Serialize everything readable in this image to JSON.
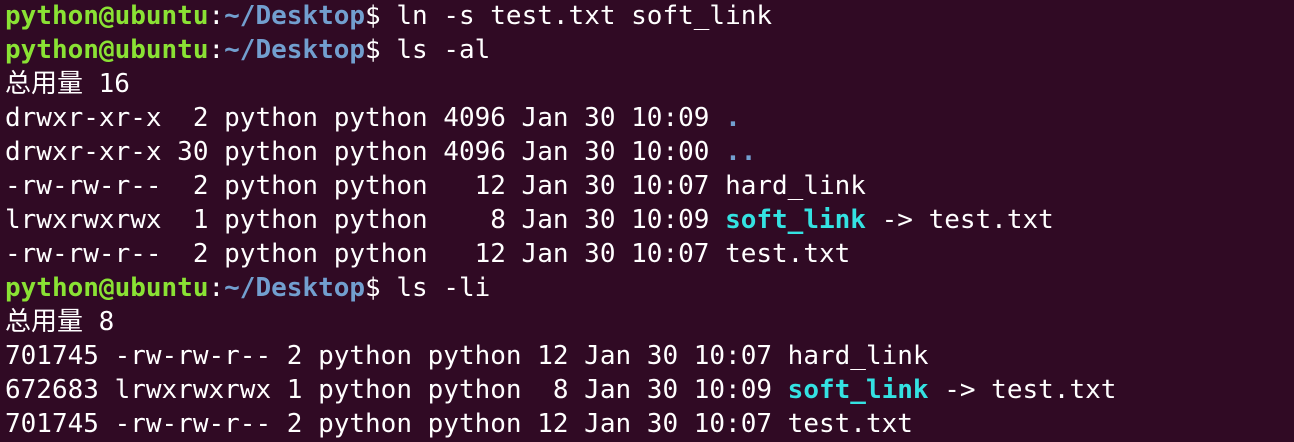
{
  "terminal": {
    "prompt": {
      "user_host": "python@ubuntu",
      "colon": ":",
      "path": "~/Desktop",
      "sign": "$"
    },
    "lines": [
      {
        "kind": "command",
        "command": " ln -s test.txt soft_link"
      },
      {
        "kind": "command",
        "command": " ls -al"
      },
      {
        "kind": "text",
        "text": "总用量 16"
      },
      {
        "kind": "entry",
        "prefix": "drwxr-xr-x  2 python python 4096 Jan 30 10:09 ",
        "name": ".",
        "name_style": "dir",
        "suffix": ""
      },
      {
        "kind": "entry",
        "prefix": "drwxr-xr-x 30 python python 4096 Jan 30 10:00 ",
        "name": "..",
        "name_style": "dir",
        "suffix": ""
      },
      {
        "kind": "entry",
        "prefix": "-rw-rw-r--  2 python python   12 Jan 30 10:07 ",
        "name": "hard_link",
        "name_style": "plain",
        "suffix": ""
      },
      {
        "kind": "entry",
        "prefix": "lrwxrwxrwx  1 python python    8 Jan 30 10:09 ",
        "name": "soft_link",
        "name_style": "link",
        "suffix": " -> test.txt"
      },
      {
        "kind": "entry",
        "prefix": "-rw-rw-r--  2 python python   12 Jan 30 10:07 ",
        "name": "test.txt",
        "name_style": "plain",
        "suffix": ""
      },
      {
        "kind": "command",
        "command": " ls -li"
      },
      {
        "kind": "text",
        "text": "总用量 8"
      },
      {
        "kind": "entry",
        "prefix": "701745 -rw-rw-r-- 2 python python 12 Jan 30 10:07 ",
        "name": "hard_link",
        "name_style": "plain",
        "suffix": ""
      },
      {
        "kind": "entry",
        "prefix": "672683 lrwxrwxrwx 1 python python  8 Jan 30 10:09 ",
        "name": "soft_link",
        "name_style": "link",
        "suffix": " -> test.txt"
      },
      {
        "kind": "entry",
        "prefix": "701745 -rw-rw-r-- 2 python python 12 Jan 30 10:07 ",
        "name": "test.txt",
        "name_style": "plain",
        "suffix": ""
      }
    ]
  },
  "colors": {
    "background": "#300a24",
    "prompt_user": "#8ae234",
    "prompt_path": "#729fcf",
    "directory": "#729fcf",
    "symlink": "#34e2e2",
    "text": "#ffffff"
  }
}
